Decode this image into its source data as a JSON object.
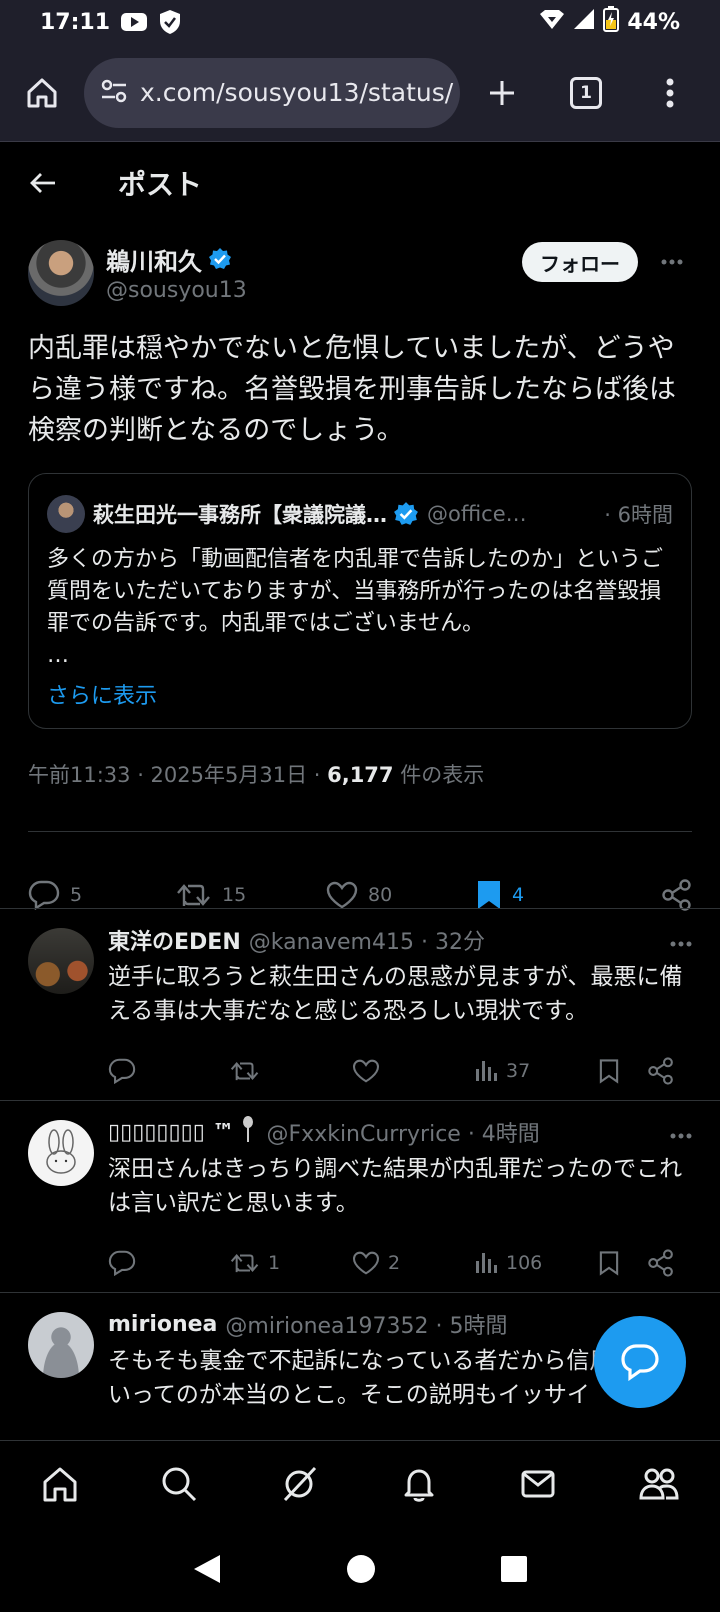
{
  "status_bar": {
    "time": "17:11",
    "battery": "44%"
  },
  "browser": {
    "url": "x.com/sousyou13/status/",
    "tab_count": "1"
  },
  "header": {
    "title": "ポスト"
  },
  "post": {
    "display_name": "鵜川和久",
    "handle": "@sousyou13",
    "follow_label": "フォロー",
    "text": "内乱罪は穏やかでないと危惧していましたが、どうやら違う様ですね。名誉毀損を刑事告訴したならば後は検察の判断となるのでしょう。",
    "quote": {
      "name": "萩生田光一事務所【衆議院議…",
      "handle": "@office…",
      "time": "· 6時間",
      "text": "多くの方から「動画配信者を内乱罪で告訴したのか」というご質問をいただいておりますが、当事務所が行ったのは名誉毀損罪での告訴です。内乱罪ではございません。",
      "ellipsis": "…",
      "show_more": "さらに表示"
    },
    "meta_time": "午前11:33 · 2025年5月31日 · ",
    "meta_views": "6,177",
    "meta_views_label": " 件の表示",
    "actions": {
      "replies": "5",
      "reposts": "15",
      "likes": "80",
      "bookmarks": "4"
    }
  },
  "replies": [
    {
      "name": "東洋のEDEN",
      "handle": "@kanavem415 · 32分",
      "text": "逆手に取ろうと萩生田さんの思惑が見ますが、最悪に備える事は大事だなと感じる恐ろしい現状です。",
      "replies": "",
      "reposts": "",
      "likes": "",
      "views": "37"
    },
    {
      "name": "▯▯▯▯▯▯▯▯ ™",
      "handle": "@FxxkinCurryrice · 4時間",
      "text": "深田さんはきっちり調べた結果が内乱罪だったのでこれは言い訳だと思います。",
      "replies": "",
      "reposts": "1",
      "likes": "2",
      "views": "106"
    },
    {
      "name": "mirionea",
      "handle": "@mirionea197352 · 5時間",
      "text": "そもそも裏金で不起訴になっている者だから信用できないってのが本当のとこ。そこの説明もイッサイ"
    }
  ],
  "colors": {
    "accent": "#1d9bf0",
    "muted": "#71767b",
    "text": "#e7e9ea",
    "background": "#000000"
  }
}
